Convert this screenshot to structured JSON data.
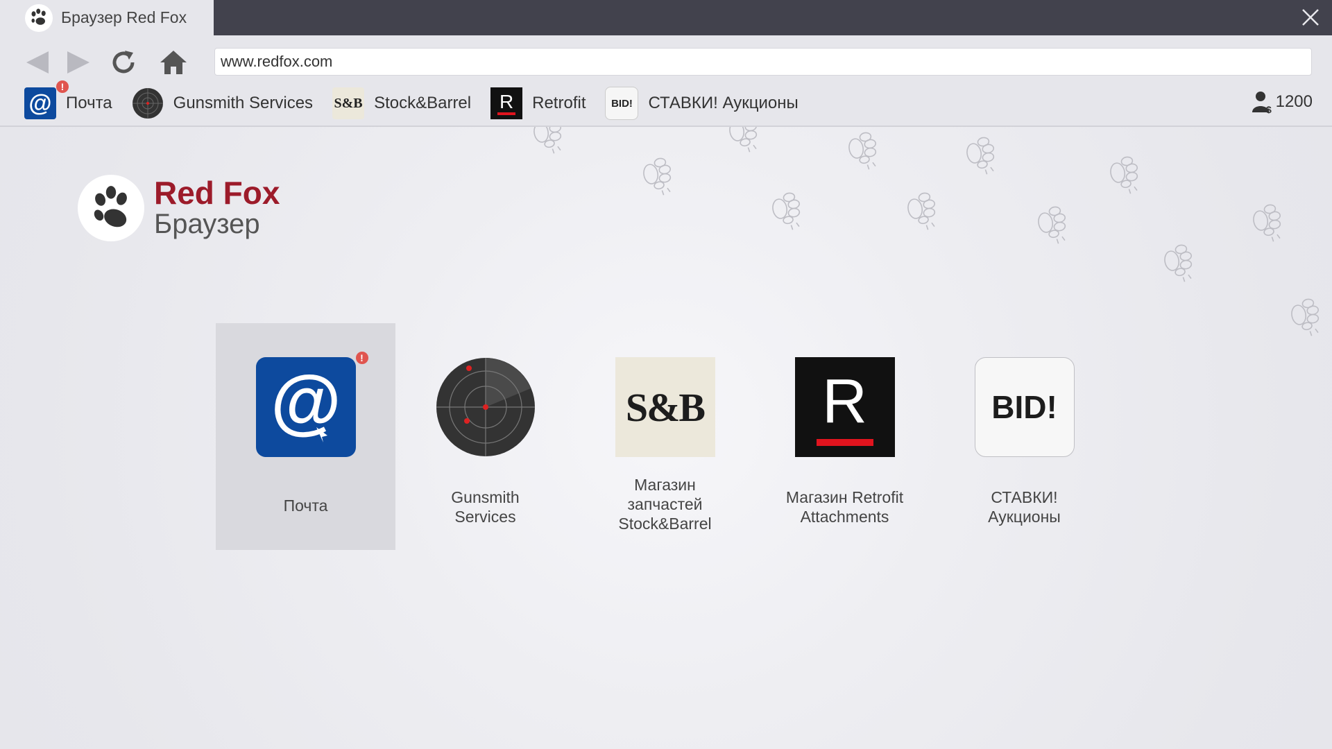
{
  "tab": {
    "title": "Браузер Red Fox"
  },
  "address": {
    "url": "www.redfox.com"
  },
  "bookmarks": [
    {
      "label": "Почта",
      "icon": "mail-icon",
      "alert": "!"
    },
    {
      "label": "Gunsmith Services",
      "icon": "radar-icon"
    },
    {
      "label": "Stock&Barrel",
      "icon": "stock-barrel-icon",
      "mark": "S&B"
    },
    {
      "label": "Retrofit",
      "icon": "retrofit-icon",
      "mark": "R"
    },
    {
      "label": "СТАВКИ! Аукционы",
      "icon": "bid-icon",
      "mark": "BID!"
    }
  ],
  "account": {
    "balance": "1200"
  },
  "logo": {
    "name": "Red Fox",
    "subtitle": "Браузер"
  },
  "tiles": [
    {
      "label": "Почта",
      "icon": "mail-icon",
      "alert": "!",
      "selected": true
    },
    {
      "label": "Gunsmith\nServices",
      "icon": "radar-icon"
    },
    {
      "label": "Магазин\nзапчастей\nStock&Barrel",
      "icon": "stock-barrel-icon",
      "mark": "S&B"
    },
    {
      "label": "Магазин Retrofit\nAttachments",
      "icon": "retrofit-icon",
      "mark": "R"
    },
    {
      "label": "СТАВКИ!\nАукционы",
      "icon": "bid-icon",
      "mark": "BID!"
    }
  ],
  "colors": {
    "titlebar": "#42424d",
    "chrome": "#e6e6eb",
    "brand": "#9c1b2a",
    "mail": "#0d4a9e",
    "alert": "#e0554f",
    "retrofit_bar": "#e0141e"
  }
}
